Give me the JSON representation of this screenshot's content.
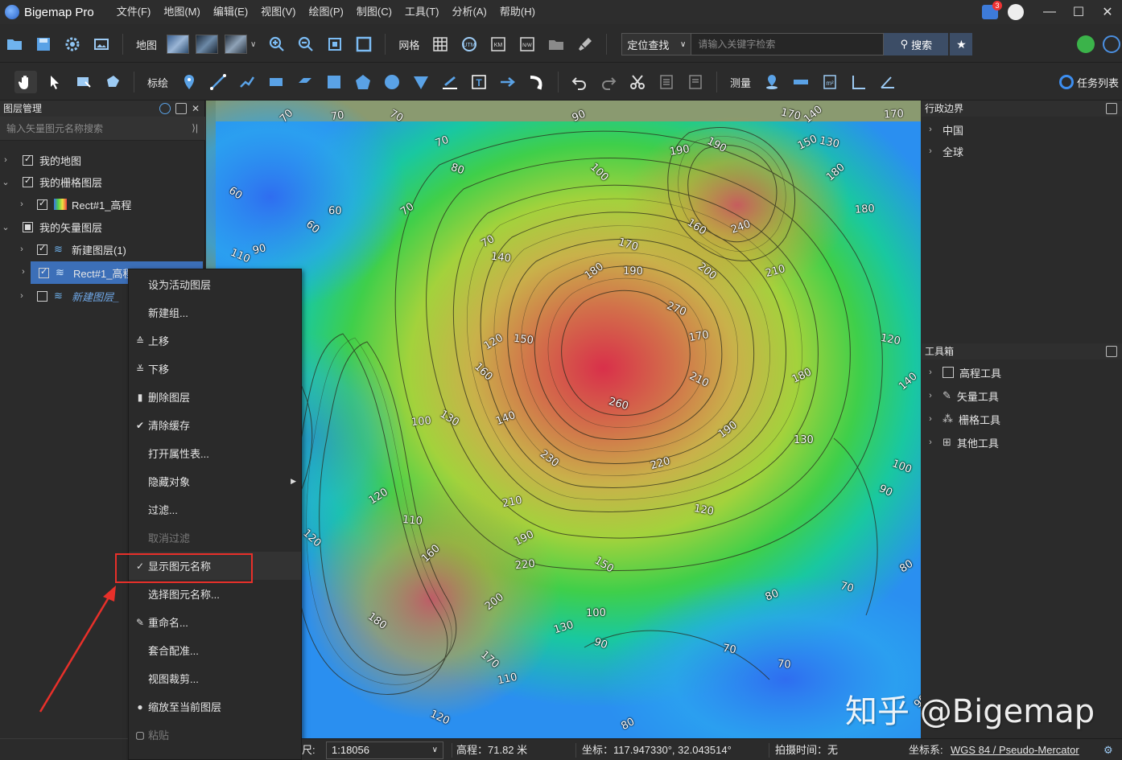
{
  "app": {
    "title": "Bigemap Pro"
  },
  "menu": [
    "文件(F)",
    "地图(M)",
    "编辑(E)",
    "视图(V)",
    "绘图(P)",
    "制图(C)",
    "工具(T)",
    "分析(A)",
    "帮助(H)"
  ],
  "notifications": {
    "count": "3"
  },
  "toolbar1": {
    "map_label": "地图",
    "grid_label": "网格",
    "locate_option": "定位查找",
    "search_placeholder": "请输入关键字检索",
    "search_button": "搜索"
  },
  "toolbar2": {
    "annotate_label": "标绘",
    "measure_label": "测量",
    "task_list_label": "任务列表"
  },
  "layer_panel": {
    "title": "图层管理",
    "search_placeholder": "输入矢量图元名称搜索",
    "items": [
      {
        "label": "我的地图",
        "checked": true
      },
      {
        "label": "我的栅格图层",
        "checked": true
      },
      {
        "label": "Rect#1_高程",
        "checked": true
      },
      {
        "label": "我的矢量图层",
        "checked": "partial"
      },
      {
        "label": "新建图层(1)",
        "checked": true
      },
      {
        "label": "Rect#1_高程_",
        "checked": true
      },
      {
        "label": "新建图层_",
        "checked": false
      }
    ]
  },
  "context_menu": {
    "items": [
      {
        "label": "设为活动图层",
        "icon": ""
      },
      {
        "label": "新建组...",
        "icon": ""
      },
      {
        "label": "上移",
        "icon": "move-up-icon"
      },
      {
        "label": "下移",
        "icon": "move-down-icon"
      },
      {
        "label": "删除图层",
        "icon": "trash-icon"
      },
      {
        "label": "清除缓存",
        "icon": "brush-icon"
      },
      {
        "label": "打开属性表...",
        "icon": ""
      },
      {
        "label": "隐藏对象",
        "icon": "",
        "submenu": true
      },
      {
        "label": "过滤...",
        "icon": ""
      },
      {
        "label": "取消过滤",
        "icon": "",
        "disabled": true
      },
      {
        "label": "显示图元名称",
        "icon": "check-icon",
        "checked": true
      },
      {
        "label": "选择图元名称...",
        "icon": ""
      },
      {
        "label": "重命名...",
        "icon": "edit-icon"
      },
      {
        "label": "套合配准...",
        "icon": ""
      },
      {
        "label": "视图裁剪...",
        "icon": ""
      },
      {
        "label": "缩放至当前图层",
        "icon": "person-icon"
      },
      {
        "label": "粘贴",
        "icon": "paste-icon",
        "disabled": true
      }
    ]
  },
  "right_panel": {
    "admin_title": "行政边界",
    "admin_items": [
      "中国",
      "全球"
    ],
    "toolbox_title": "工具箱",
    "toolbox_items": [
      "高程工具",
      "矢量工具",
      "栅格工具",
      "其他工具"
    ]
  },
  "map": {
    "contour_labels": [
      "70",
      "70",
      "70",
      "90",
      "170",
      "140",
      "170",
      "60",
      "70",
      "80",
      "70",
      "60",
      "60",
      "90",
      "110",
      "70",
      "140",
      "100",
      "190",
      "190",
      "150",
      "130",
      "180",
      "180",
      "160",
      "240",
      "170",
      "180",
      "190",
      "200",
      "210",
      "270",
      "120",
      "150",
      "160",
      "170",
      "210",
      "180",
      "120",
      "140",
      "100",
      "130",
      "140",
      "260",
      "190",
      "130",
      "230",
      "220",
      "100",
      "120",
      "110",
      "120",
      "210",
      "90",
      "190",
      "120",
      "160",
      "220",
      "150",
      "80",
      "70",
      "200",
      "100",
      "180",
      "130",
      "90",
      "80",
      "70",
      "170",
      "110",
      "120",
      "80",
      "70",
      "90"
    ]
  },
  "statusbar": {
    "scale_prefix": "尺:",
    "scale": "1:18056",
    "elevation": "高程：71.82 米",
    "coords": "坐标：117.947330°, 32.043514°",
    "capture_time": "拍摄时间：无",
    "crs_prefix": "坐标系:",
    "crs": "WGS 84 / Pseudo-Mercator"
  },
  "watermark": "知乎 @Bigemap"
}
